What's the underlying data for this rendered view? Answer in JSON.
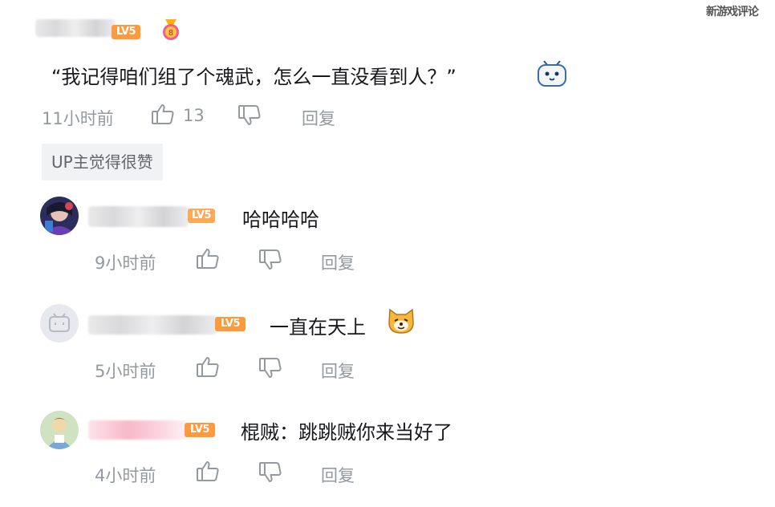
{
  "watermark": "新游戏评论",
  "main_comment": {
    "level": "LV5",
    "text": "“我记得咱们组了个魂武，怎么一直没看到人？”",
    "time": "11小时前",
    "likes": "13",
    "reply_label": "回复",
    "up_badge": "UP主觉得很赞"
  },
  "replies": [
    {
      "level": "LV5",
      "text": "哈哈哈哈",
      "time": "9小时前",
      "reply_label": "回复"
    },
    {
      "level": "LV5",
      "text": "一直在天上",
      "time": "5小时前",
      "reply_label": "回复"
    },
    {
      "level": "LV5",
      "text": "棍贼：跳跳贼你来当好了",
      "time": "4小时前",
      "reply_label": "回复"
    }
  ],
  "icons": {
    "thumb_up": "thumb-up-icon",
    "thumb_down": "thumb-down-icon",
    "medal": "medal-icon",
    "emoji_tv": "tv-face-emoji-icon",
    "emoji_dog": "dog-face-emoji-icon"
  },
  "colors": {
    "level_badge": "#ff9a3c",
    "meta_text": "#9499a0",
    "body_text": "#18191c"
  }
}
